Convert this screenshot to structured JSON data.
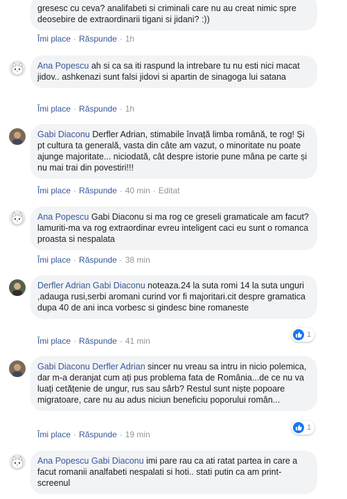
{
  "comments": [
    {
      "text": "gresesc cu ceva? analifabeti si criminali care nu au creat nimic spre deosebire de extraordinarii tigani si jidani? :))",
      "like": "Îmi place",
      "reply": "Răspunde",
      "time": "1h"
    },
    {
      "author": "Ana Popescu",
      "text": "ah si ca sa iti raspund la intrebare tu nu esti nici macat jidov.. ashkenazi sunt falsi jidovi si apartin de sinagoga lui satana",
      "like": "Îmi place",
      "reply": "Răspunde",
      "time": "1h",
      "avatar": "cat-avatar"
    },
    {
      "author": "Gabi Diaconu",
      "text": "Derfler Adrian, stimabile învață limba română, te rog! Și pt cultura ta generală, vasta din câte am vazut, o minoritate nu poate ajunge majoritate... niciodată, cât despre istorie pune mâna pe carte și nu mai trai din povestiri!!!",
      "like": "Îmi place",
      "reply": "Răspunde",
      "time": "40 min",
      "edited": "Editat",
      "avatar": "person-avatar"
    },
    {
      "author": "Ana Popescu",
      "text": "Gabi Diaconu si ma rog ce greseli gramaticale am facut? lamuriti-ma va rog extraordinar evreu inteligent caci eu sunt o romanca proasta si nespalata",
      "like": "Îmi place",
      "reply": "Răspunde",
      "time": "38 min",
      "avatar": "cat-avatar"
    },
    {
      "author": "Derfler Adrian",
      "mention": "Gabi Diaconu",
      "text": "noteaza.24 la suta romi 14 la suta unguri ,adauga rusi,serbi aromani curind vor fi majoritari.cit despre gramatica dupa 40 de ani inca vorbesc si gindesc bine romaneste",
      "like": "Îmi place",
      "reply": "Răspunde",
      "time": "41 min",
      "reactions": "1",
      "avatar": "person-avatar"
    },
    {
      "author": "Gabi Diaconu",
      "mention": "Derfler Adrian",
      "text": "sincer nu vreau sa intru in nicio polemica, dar m-a deranjat cum ați pus problema fata de România...de ce nu va luați cetățenie de ungur, rus sau sârb? Restul sunt niște popoare migratoare, care nu au adus niciun beneficiu poporului român...",
      "like": "Îmi place",
      "reply": "Răspunde",
      "time": "19 min",
      "reactions": "1",
      "avatar": "person-avatar"
    },
    {
      "author": "Ana Popescu",
      "mention": "Gabi Diaconu",
      "text": "imi pare rau ca ati ratat partea in care a facut romanii analfabeti nespalati si hoti.. stati putin ca am print-screenul",
      "avatar": "cat-avatar"
    }
  ]
}
